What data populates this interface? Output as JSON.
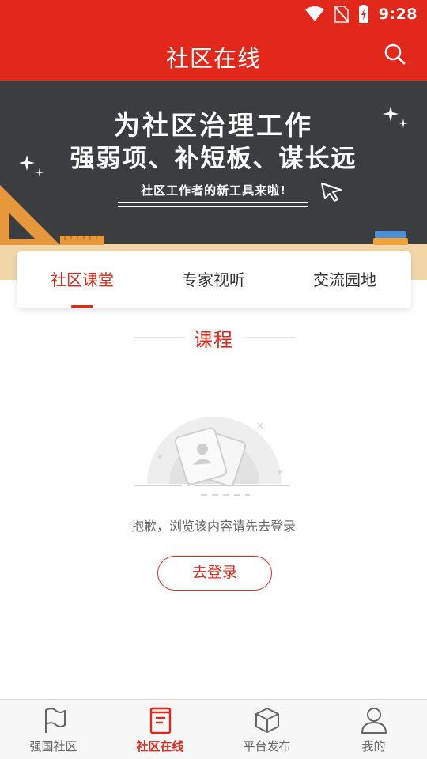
{
  "status_bar": {
    "time": "9:28"
  },
  "header": {
    "title": "社区在线",
    "search_icon": "search-icon"
  },
  "banner": {
    "line1": "为社区治理工作",
    "line2": "强弱项、补短板、谋长远",
    "line3": "社区工作者的新工具来啦!"
  },
  "tabs": [
    {
      "label": "社区课堂",
      "active": true
    },
    {
      "label": "专家视听",
      "active": false
    },
    {
      "label": "交流园地",
      "active": false
    }
  ],
  "section": {
    "title": "课程"
  },
  "empty_state": {
    "message": "抱歉，浏览该内容请先去登录",
    "button_label": "去登录"
  },
  "bottom_nav": [
    {
      "label": "强国社区",
      "icon": "flag-icon",
      "active": false
    },
    {
      "label": "社区在线",
      "icon": "book-icon",
      "active": true
    },
    {
      "label": "平台发布",
      "icon": "cube-icon",
      "active": false
    },
    {
      "label": "我的",
      "icon": "user-icon",
      "active": false
    }
  ],
  "colors": {
    "accent": "#e2281b",
    "banner_bg": "#3b3d3f",
    "banner_floor": "#f3d6a8"
  }
}
